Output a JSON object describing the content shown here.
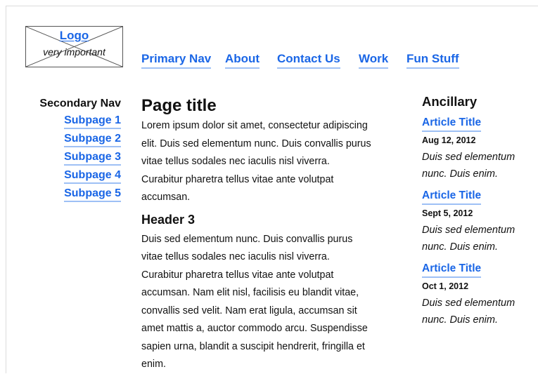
{
  "logo": {
    "label": "Logo",
    "subtitle": "very important"
  },
  "primary_nav": {
    "items": [
      {
        "label": "Primary Nav"
      },
      {
        "label": "About"
      },
      {
        "label": "Contact Us"
      },
      {
        "label": "Work"
      },
      {
        "label": "Fun Stuff"
      }
    ]
  },
  "secondary_nav": {
    "title": "Secondary Nav",
    "items": [
      {
        "label": "Subpage 1"
      },
      {
        "label": "Subpage 2"
      },
      {
        "label": "Subpage 3"
      },
      {
        "label": "Subpage 4"
      },
      {
        "label": "Subpage 5"
      }
    ]
  },
  "main": {
    "title": "Page title",
    "intro_lines": [
      "Lorem ipsum dolor sit amet, consectetur adipiscing",
      "elit. Duis sed elementum nunc. Duis convallis purus",
      "vitae tellus sodales nec iaculis nisl viverra.",
      "Curabitur pharetra tellus vitae ante volutpat",
      "accumsan."
    ],
    "header3": "Header 3",
    "body_lines": [
      "Duis sed elementum nunc. Duis convallis purus",
      "vitae tellus sodales nec iaculis nisl viverra.",
      "Curabitur pharetra tellus vitae ante volutpat",
      "accumsan. Nam elit nisl, facilisis eu blandit vitae,",
      "convallis sed velit. Nam erat ligula, accumsan sit",
      "amet mattis a, auctor commodo arcu. Suspendisse",
      "sapien urna, blandit a suscipit hendrerit, fringilla et",
      "enim."
    ]
  },
  "ancillary": {
    "title": "Ancillary",
    "articles": [
      {
        "title": "Article Title",
        "date": "Aug 12, 2012",
        "text_lines": [
          "Duis sed elementum",
          "nunc. Duis enim."
        ]
      },
      {
        "title": "Article Title",
        "date": "Sept 5, 2012",
        "text_lines": [
          "Duis sed elementum",
          "nunc. Duis enim."
        ]
      },
      {
        "title": "Article Title",
        "date": "Oct 1, 2012",
        "text_lines": [
          "Duis sed elementum",
          "nunc. Duis enim."
        ]
      }
    ]
  },
  "colors": {
    "link": "#1a66e6",
    "link_underline": "#9ec0f5",
    "text": "#111111"
  }
}
